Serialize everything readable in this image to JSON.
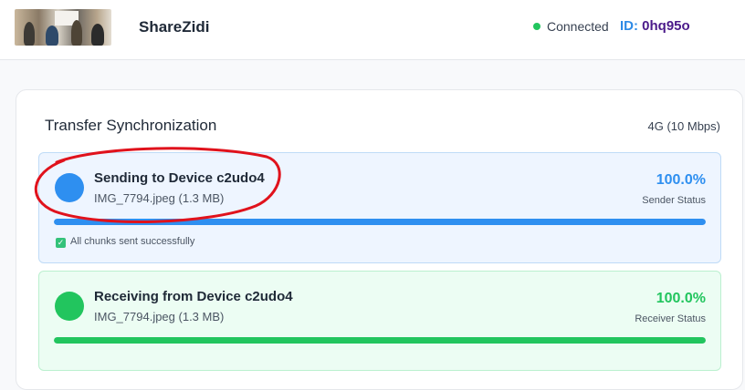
{
  "header": {
    "app_name": "ShareZidi",
    "connection_status": "Connected",
    "id_label": "ID:",
    "id_value": "0hq95o"
  },
  "card": {
    "title": "Transfer Synchronization",
    "network": "4G (10 Mbps)"
  },
  "sender": {
    "title": "Sending to Device c2udo4",
    "file": "IMG_7794.jpeg (1.3 MB)",
    "percent_label": "100.0%",
    "progress": 1.0,
    "status_label": "Sender Status",
    "check_message": "All chunks sent successfully"
  },
  "receiver": {
    "title": "Receiving from Device c2udo4",
    "file": "IMG_7794.jpeg (1.3 MB)",
    "percent_label": "100.0%",
    "progress": 1.0,
    "status_label": "Receiver Status"
  },
  "colors": {
    "accent_blue": "#2e8ff0",
    "success_green": "#22c55e",
    "id_purple": "#4b1a8a",
    "annotation_red": "#e0121c"
  }
}
